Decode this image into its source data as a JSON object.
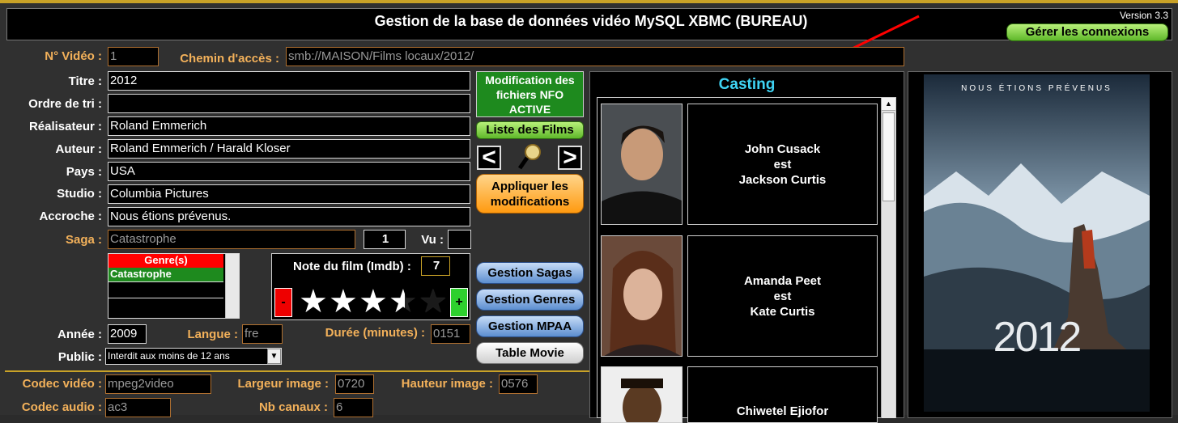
{
  "header": {
    "title": "Gestion de la base de données vidéo MySQL XBMC (BUREAU)",
    "version": "Version 3.3",
    "connections_button": "Gérer les connexions"
  },
  "fields": {
    "no_video_label": "N° Vidéo :",
    "no_video": "1",
    "path_label": "Chemin d'accès :",
    "path": "smb://MAISON/Films locaux/2012/",
    "titre_label": "Titre :",
    "titre": "2012",
    "ordre_label": "Ordre de tri :",
    "ordre": "",
    "realisateur_label": "Réalisateur :",
    "realisateur": "Roland Emmerich",
    "auteur_label": "Auteur :",
    "auteur": "Roland Emmerich / Harald Kloser",
    "pays_label": "Pays :",
    "pays": "USA",
    "studio_label": "Studio :",
    "studio": "Columbia Pictures",
    "accroche_label": "Accroche :",
    "accroche": "Nous étions prévenus.",
    "saga_label": "Saga :",
    "saga": "Catastrophe",
    "saga_num": "1",
    "vu_label": "Vu :",
    "vu": "",
    "annee_label": "Année :",
    "annee": "2009",
    "langue_label": "Langue :",
    "langue": "fre",
    "duree_label": "Durée (minutes) :",
    "duree": "0151",
    "public_label": "Public :",
    "public": "Interdit aux moins de 12 ans",
    "codec_video_label": "Codec vidéo :",
    "codec_video": "mpeg2video",
    "largeur_label": "Largeur image :",
    "largeur": "0720",
    "hauteur_label": "Hauteur image :",
    "hauteur": "0576",
    "codec_audio_label": "Codec audio :",
    "codec_audio": "ac3",
    "canaux_label": "Nb canaux :",
    "canaux": "6"
  },
  "genres": {
    "header": "Genre(s)",
    "items": [
      "Catastrophe",
      "",
      ""
    ]
  },
  "rating": {
    "label": "Note du film (Imdb) :",
    "value": "7",
    "stars": 3.5,
    "minus": "-",
    "plus": "+"
  },
  "actions": {
    "nfo": "Modification des fichiers NFO ACTIVE",
    "liste_films": "Liste des Films",
    "prev": "<",
    "next": ">",
    "appliquer": "Appliquer les modifications",
    "sagas": "Gestion Sagas",
    "genres": "Gestion Genres",
    "mpaa": "Gestion MPAA",
    "table": "Table Movie"
  },
  "casting": {
    "title": "Casting",
    "est": "est",
    "actors": [
      {
        "name": "John Cusack",
        "role": "Jackson Curtis"
      },
      {
        "name": "Amanda Peet",
        "role": "Kate Curtis"
      },
      {
        "name": "Chiwetel Ejiofor",
        "role": ""
      }
    ]
  },
  "poster": {
    "tagline": "NOUS ÉTIONS PRÉVENUS",
    "title": "2012"
  },
  "colors": {
    "accent": "#f3b15a",
    "green": "#1e8a1e",
    "red": "#ff0000",
    "cyan": "#3fd3f3"
  }
}
